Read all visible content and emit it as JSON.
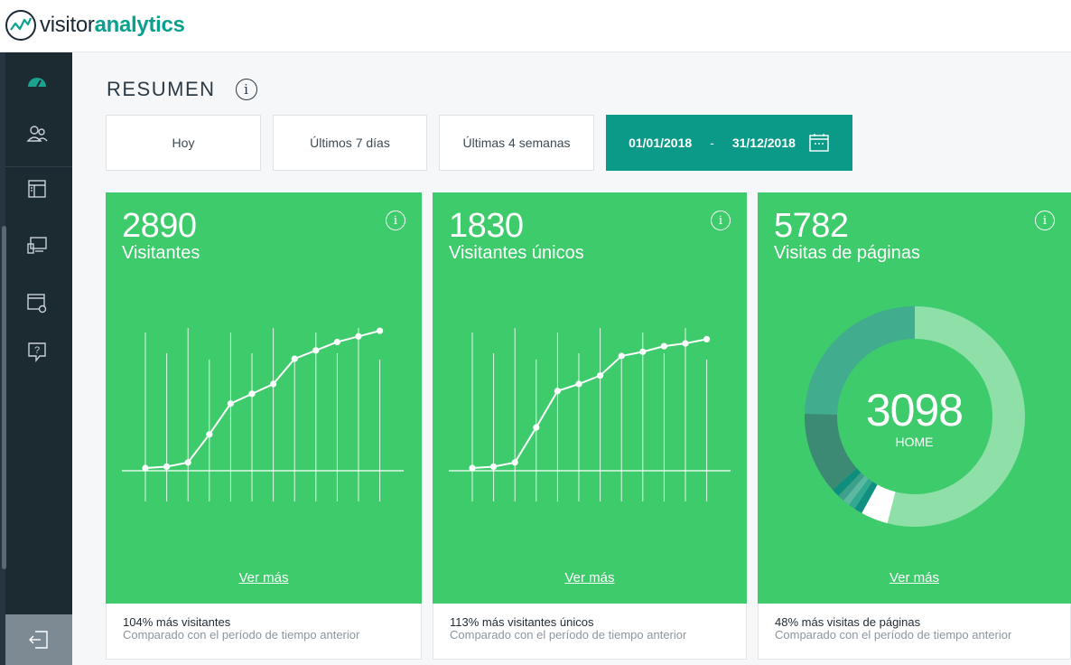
{
  "app": {
    "logo_light": "visitor",
    "logo_bold": "analytics"
  },
  "page": {
    "title": "RESUMEN",
    "info_glyph": "i"
  },
  "ranges": {
    "today": "Hoy",
    "last7": "Últimos 7 días",
    "last4w": "Últimas 4 semanas",
    "from": "01/01/2018",
    "separator": "-",
    "to": "31/12/2018"
  },
  "sidebar": {
    "items": [
      "dashboard-icon",
      "users-icon",
      "layout-icon",
      "devices-icon",
      "settings-window-icon",
      "help-icon"
    ],
    "logout": "logout-icon"
  },
  "colors": {
    "green": "#3ecb6c",
    "teal": "#0a9a87",
    "sidebar": "#1c2a32"
  },
  "cards": [
    {
      "value": "2890",
      "label": "Visitantes",
      "more": "Ver más",
      "foot_main": "104% más visitantes",
      "foot_sub": "Comparado con el período de tiempo anterior"
    },
    {
      "value": "1830",
      "label": "Visitantes únicos",
      "more": "Ver más",
      "foot_main": "113% más visitantes únicos",
      "foot_sub": "Comparado con el período de tiempo anterior"
    },
    {
      "value": "5782",
      "label": "Visitas de páginas",
      "more": "Ver más",
      "foot_main": "48% más visitas de páginas",
      "foot_sub": "Comparado con el período de tiempo anterior",
      "donut_value": "3098",
      "donut_label": "HOME"
    }
  ],
  "chart_data": [
    {
      "type": "line",
      "series": [
        {
          "values": [
            0,
            1,
            4,
            24,
            46,
            53,
            60,
            78,
            84,
            90,
            94,
            98
          ]
        }
      ],
      "ylim": [
        0,
        100
      ]
    },
    {
      "type": "line",
      "series": [
        {
          "values": [
            0,
            1,
            4,
            29,
            55,
            60,
            66,
            80,
            83,
            87,
            89,
            92
          ]
        }
      ],
      "ylim": [
        0,
        100
      ]
    },
    {
      "type": "pie",
      "values": [
        54,
        4,
        1.2,
        1,
        1,
        1,
        1.2,
        12,
        24.6
      ],
      "colors": [
        "#8ee0a8",
        "#ffffff",
        "#118f80",
        "#33a890",
        "#5cb8a0",
        "#3e9f8a",
        "#0e8f7e",
        "#3d8a74",
        "#41ad8e"
      ]
    }
  ]
}
